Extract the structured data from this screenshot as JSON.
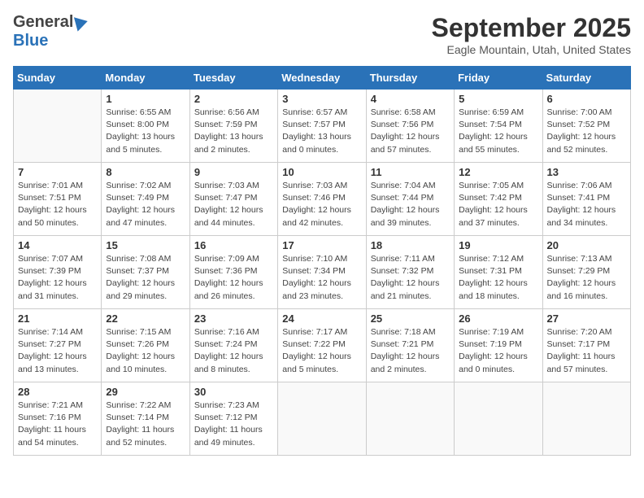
{
  "header": {
    "logo_general": "General",
    "logo_blue": "Blue",
    "month": "September 2025",
    "location": "Eagle Mountain, Utah, United States"
  },
  "days_of_week": [
    "Sunday",
    "Monday",
    "Tuesday",
    "Wednesday",
    "Thursday",
    "Friday",
    "Saturday"
  ],
  "weeks": [
    [
      {
        "day": "",
        "info": ""
      },
      {
        "day": "1",
        "info": "Sunrise: 6:55 AM\nSunset: 8:00 PM\nDaylight: 13 hours\nand 5 minutes."
      },
      {
        "day": "2",
        "info": "Sunrise: 6:56 AM\nSunset: 7:59 PM\nDaylight: 13 hours\nand 2 minutes."
      },
      {
        "day": "3",
        "info": "Sunrise: 6:57 AM\nSunset: 7:57 PM\nDaylight: 13 hours\nand 0 minutes."
      },
      {
        "day": "4",
        "info": "Sunrise: 6:58 AM\nSunset: 7:56 PM\nDaylight: 12 hours\nand 57 minutes."
      },
      {
        "day": "5",
        "info": "Sunrise: 6:59 AM\nSunset: 7:54 PM\nDaylight: 12 hours\nand 55 minutes."
      },
      {
        "day": "6",
        "info": "Sunrise: 7:00 AM\nSunset: 7:52 PM\nDaylight: 12 hours\nand 52 minutes."
      }
    ],
    [
      {
        "day": "7",
        "info": "Sunrise: 7:01 AM\nSunset: 7:51 PM\nDaylight: 12 hours\nand 50 minutes."
      },
      {
        "day": "8",
        "info": "Sunrise: 7:02 AM\nSunset: 7:49 PM\nDaylight: 12 hours\nand 47 minutes."
      },
      {
        "day": "9",
        "info": "Sunrise: 7:03 AM\nSunset: 7:47 PM\nDaylight: 12 hours\nand 44 minutes."
      },
      {
        "day": "10",
        "info": "Sunrise: 7:03 AM\nSunset: 7:46 PM\nDaylight: 12 hours\nand 42 minutes."
      },
      {
        "day": "11",
        "info": "Sunrise: 7:04 AM\nSunset: 7:44 PM\nDaylight: 12 hours\nand 39 minutes."
      },
      {
        "day": "12",
        "info": "Sunrise: 7:05 AM\nSunset: 7:42 PM\nDaylight: 12 hours\nand 37 minutes."
      },
      {
        "day": "13",
        "info": "Sunrise: 7:06 AM\nSunset: 7:41 PM\nDaylight: 12 hours\nand 34 minutes."
      }
    ],
    [
      {
        "day": "14",
        "info": "Sunrise: 7:07 AM\nSunset: 7:39 PM\nDaylight: 12 hours\nand 31 minutes."
      },
      {
        "day": "15",
        "info": "Sunrise: 7:08 AM\nSunset: 7:37 PM\nDaylight: 12 hours\nand 29 minutes."
      },
      {
        "day": "16",
        "info": "Sunrise: 7:09 AM\nSunset: 7:36 PM\nDaylight: 12 hours\nand 26 minutes."
      },
      {
        "day": "17",
        "info": "Sunrise: 7:10 AM\nSunset: 7:34 PM\nDaylight: 12 hours\nand 23 minutes."
      },
      {
        "day": "18",
        "info": "Sunrise: 7:11 AM\nSunset: 7:32 PM\nDaylight: 12 hours\nand 21 minutes."
      },
      {
        "day": "19",
        "info": "Sunrise: 7:12 AM\nSunset: 7:31 PM\nDaylight: 12 hours\nand 18 minutes."
      },
      {
        "day": "20",
        "info": "Sunrise: 7:13 AM\nSunset: 7:29 PM\nDaylight: 12 hours\nand 16 minutes."
      }
    ],
    [
      {
        "day": "21",
        "info": "Sunrise: 7:14 AM\nSunset: 7:27 PM\nDaylight: 12 hours\nand 13 minutes."
      },
      {
        "day": "22",
        "info": "Sunrise: 7:15 AM\nSunset: 7:26 PM\nDaylight: 12 hours\nand 10 minutes."
      },
      {
        "day": "23",
        "info": "Sunrise: 7:16 AM\nSunset: 7:24 PM\nDaylight: 12 hours\nand 8 minutes."
      },
      {
        "day": "24",
        "info": "Sunrise: 7:17 AM\nSunset: 7:22 PM\nDaylight: 12 hours\nand 5 minutes."
      },
      {
        "day": "25",
        "info": "Sunrise: 7:18 AM\nSunset: 7:21 PM\nDaylight: 12 hours\nand 2 minutes."
      },
      {
        "day": "26",
        "info": "Sunrise: 7:19 AM\nSunset: 7:19 PM\nDaylight: 12 hours\nand 0 minutes."
      },
      {
        "day": "27",
        "info": "Sunrise: 7:20 AM\nSunset: 7:17 PM\nDaylight: 11 hours\nand 57 minutes."
      }
    ],
    [
      {
        "day": "28",
        "info": "Sunrise: 7:21 AM\nSunset: 7:16 PM\nDaylight: 11 hours\nand 54 minutes."
      },
      {
        "day": "29",
        "info": "Sunrise: 7:22 AM\nSunset: 7:14 PM\nDaylight: 11 hours\nand 52 minutes."
      },
      {
        "day": "30",
        "info": "Sunrise: 7:23 AM\nSunset: 7:12 PM\nDaylight: 11 hours\nand 49 minutes."
      },
      {
        "day": "",
        "info": ""
      },
      {
        "day": "",
        "info": ""
      },
      {
        "day": "",
        "info": ""
      },
      {
        "day": "",
        "info": ""
      }
    ]
  ]
}
